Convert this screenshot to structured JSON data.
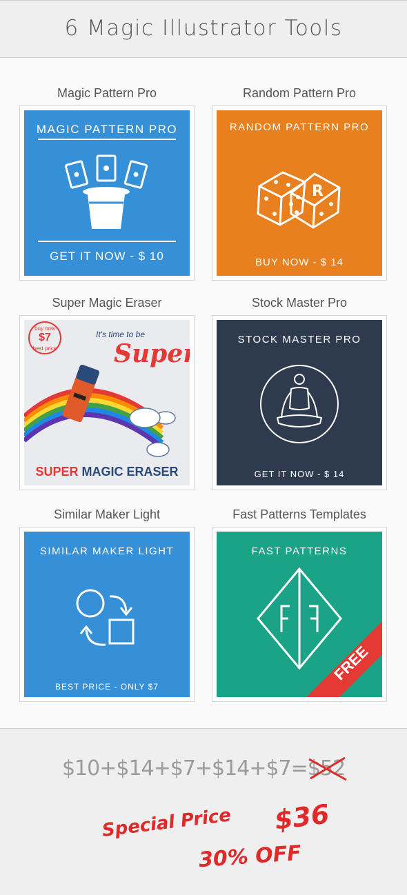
{
  "header": {
    "title": "6 Magic Illustrator Tools"
  },
  "products": [
    {
      "name": "Magic Pattern Pro",
      "tile_title": "MAGIC PATTERN PRO",
      "cta": "GET IT NOW - $ 10",
      "bg": "#3590d8"
    },
    {
      "name": "Random Pattern Pro",
      "tile_title": "RANDOM PATTERN PRO",
      "cta": "BUY NOW - $ 14",
      "bg": "#e8801f"
    },
    {
      "name": "Super Magic Eraser",
      "badge_top": "buy now",
      "badge_price": "$7",
      "badge_bottom": "best price",
      "tagline": "It's time to be",
      "super_word": "Super",
      "tile_title_red": "SUPER",
      "tile_title_dark": "MAGIC ERASER",
      "bg": "#e9ebee"
    },
    {
      "name": "Stock Master Pro",
      "tile_title": "STOCK MASTER PRO",
      "cta": "GET IT NOW - $ 14",
      "bg": "#2e3b4e"
    },
    {
      "name": "Similar Maker Light",
      "tile_title": "SIMILAR MAKER LIGHT",
      "cta": "BEST PRICE - ONLY $7",
      "bg": "#3590d8"
    },
    {
      "name": "Fast Patterns Templates",
      "tile_title": "FAST PATTERNS",
      "ribbon": "FREE",
      "bg": "#1aa387"
    }
  ],
  "footer": {
    "sum_prefix": "$10+$14+$7+$14+$7=",
    "sum_total": "$52",
    "special_label": "Special Price",
    "special_price": "$36",
    "discount": "30% OFF"
  }
}
